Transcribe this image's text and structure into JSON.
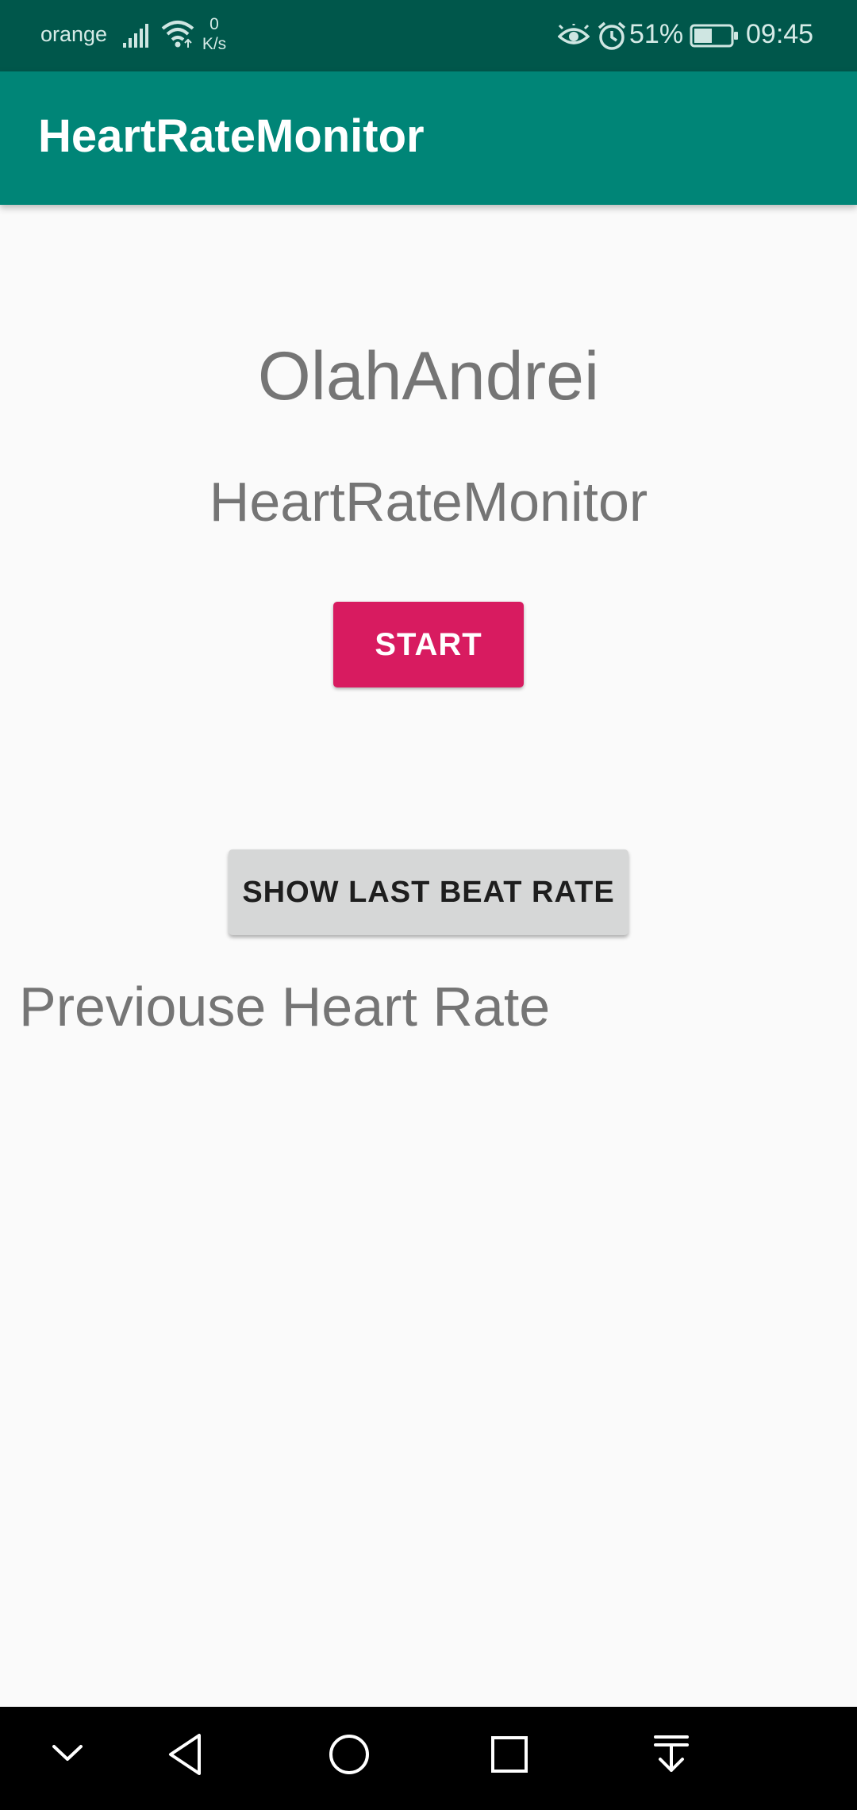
{
  "status_bar": {
    "carrier": "orange",
    "net_speed_value": "0",
    "net_speed_unit": "K/s",
    "battery_percent": "51%",
    "time": "09:45",
    "icons": [
      "signal-icon",
      "wifi-icon",
      "eye-comfort-icon",
      "alarm-icon",
      "battery-icon"
    ],
    "battery_level": 0.51
  },
  "app_bar": {
    "title": "HeartRateMonitor",
    "color": "#008577"
  },
  "main": {
    "name": "OlahAndrei",
    "subtitle": "HeartRateMonitor",
    "start_button_label": "START",
    "start_button_color": "#d81b60",
    "show_last_button_label": "SHOW LAST BEAT RATE",
    "previous_label": "Previouse Heart Rate"
  },
  "nav_bar": {
    "buttons": [
      "collapse-icon",
      "back-icon",
      "home-icon",
      "recents-icon",
      "notification-pulldown-icon"
    ]
  }
}
